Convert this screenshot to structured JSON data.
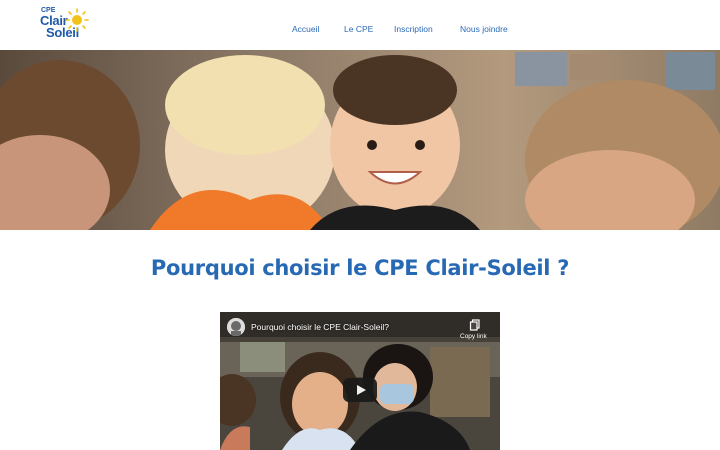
{
  "header": {
    "logo": {
      "small_text": "CPE",
      "line1": "Clair",
      "line2": "Soleil"
    },
    "nav": [
      {
        "label": "Accueil"
      },
      {
        "label": "Le CPE"
      },
      {
        "label": "Inscription"
      },
      {
        "label": "Nous joindre"
      }
    ]
  },
  "hero": {
    "icon": "hero-photo"
  },
  "main": {
    "title": "Pourquoi choisir le CPE Clair-Soleil ?"
  },
  "video": {
    "title": "Pourquoi choisir le CPE Clair-Soleil?",
    "copy_label": "Copy link"
  },
  "colors": {
    "brand_blue": "#2869b4",
    "nav_blue": "#2a6ab8",
    "sun_yellow": "#f2c21a"
  }
}
